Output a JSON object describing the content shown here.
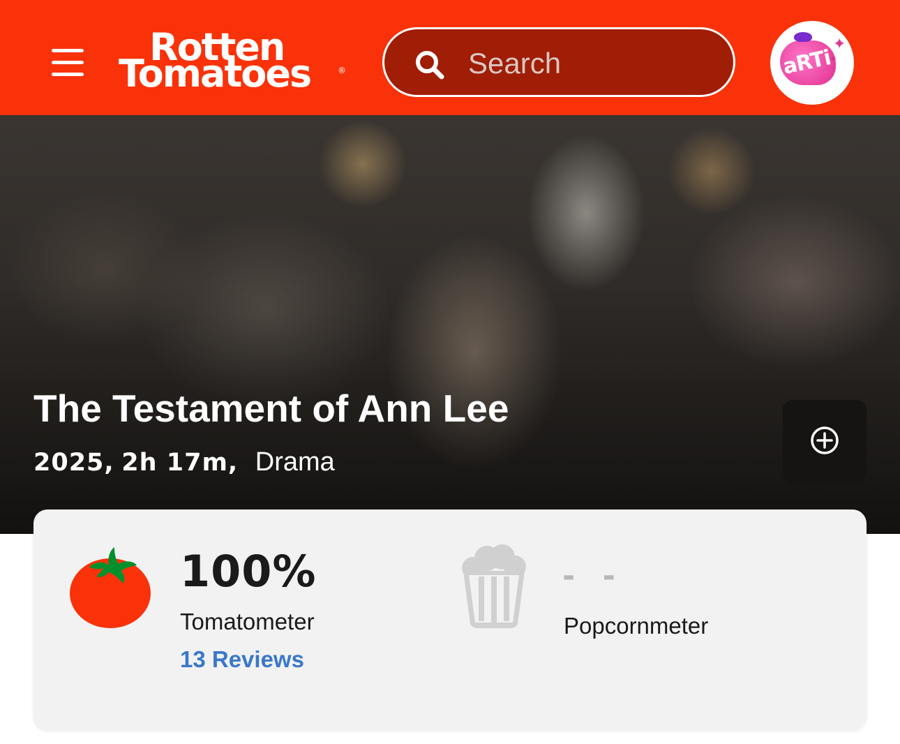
{
  "header": {
    "logo_line1": "Rotten",
    "logo_line2": "Tomatoes",
    "logo_reg": "®",
    "search": {
      "placeholder": "Search",
      "value": ""
    },
    "avatar_text": "aRTi"
  },
  "movie": {
    "title": "The Testament of Ann Lee",
    "year": "2025,",
    "runtime": "2h 17m,",
    "genre": "Drama"
  },
  "scores": {
    "tomatometer": {
      "value": "100%",
      "label": "Tomatometer",
      "reviews": "13 Reviews"
    },
    "popcornmeter": {
      "value": "- -",
      "label": "Popcornmeter"
    }
  },
  "colors": {
    "brand": "#fa320a",
    "search_bg": "#a01d06",
    "link": "#3a78c9",
    "card_bg": "#f2f2f2"
  },
  "icons": [
    "menu-icon",
    "search-icon",
    "plus-circle-icon",
    "tomato-icon",
    "popcorn-icon"
  ]
}
